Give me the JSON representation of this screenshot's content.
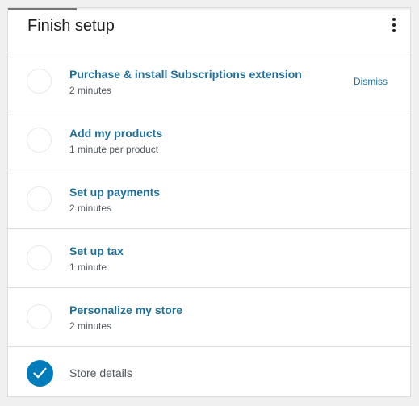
{
  "card": {
    "title": "Finish setup",
    "progress_fraction": 0.17
  },
  "tasks": [
    {
      "title": "Purchase & install Subscriptions extension",
      "time": "2 minutes",
      "dismiss_label": "Dismiss",
      "completed": false
    },
    {
      "title": "Add my products",
      "time": "1 minute per product",
      "completed": false
    },
    {
      "title": "Set up payments",
      "time": "2 minutes",
      "completed": false
    },
    {
      "title": "Set up tax",
      "time": "1 minute",
      "completed": false
    },
    {
      "title": "Personalize my store",
      "time": "2 minutes",
      "completed": false
    },
    {
      "title": "Store details",
      "completed": true
    }
  ],
  "colors": {
    "accent": "#007cba",
    "link": "#1f6f98",
    "progress": "#757575"
  },
  "icons": {
    "menu": "more-vertical-icon",
    "check": "check-icon"
  }
}
